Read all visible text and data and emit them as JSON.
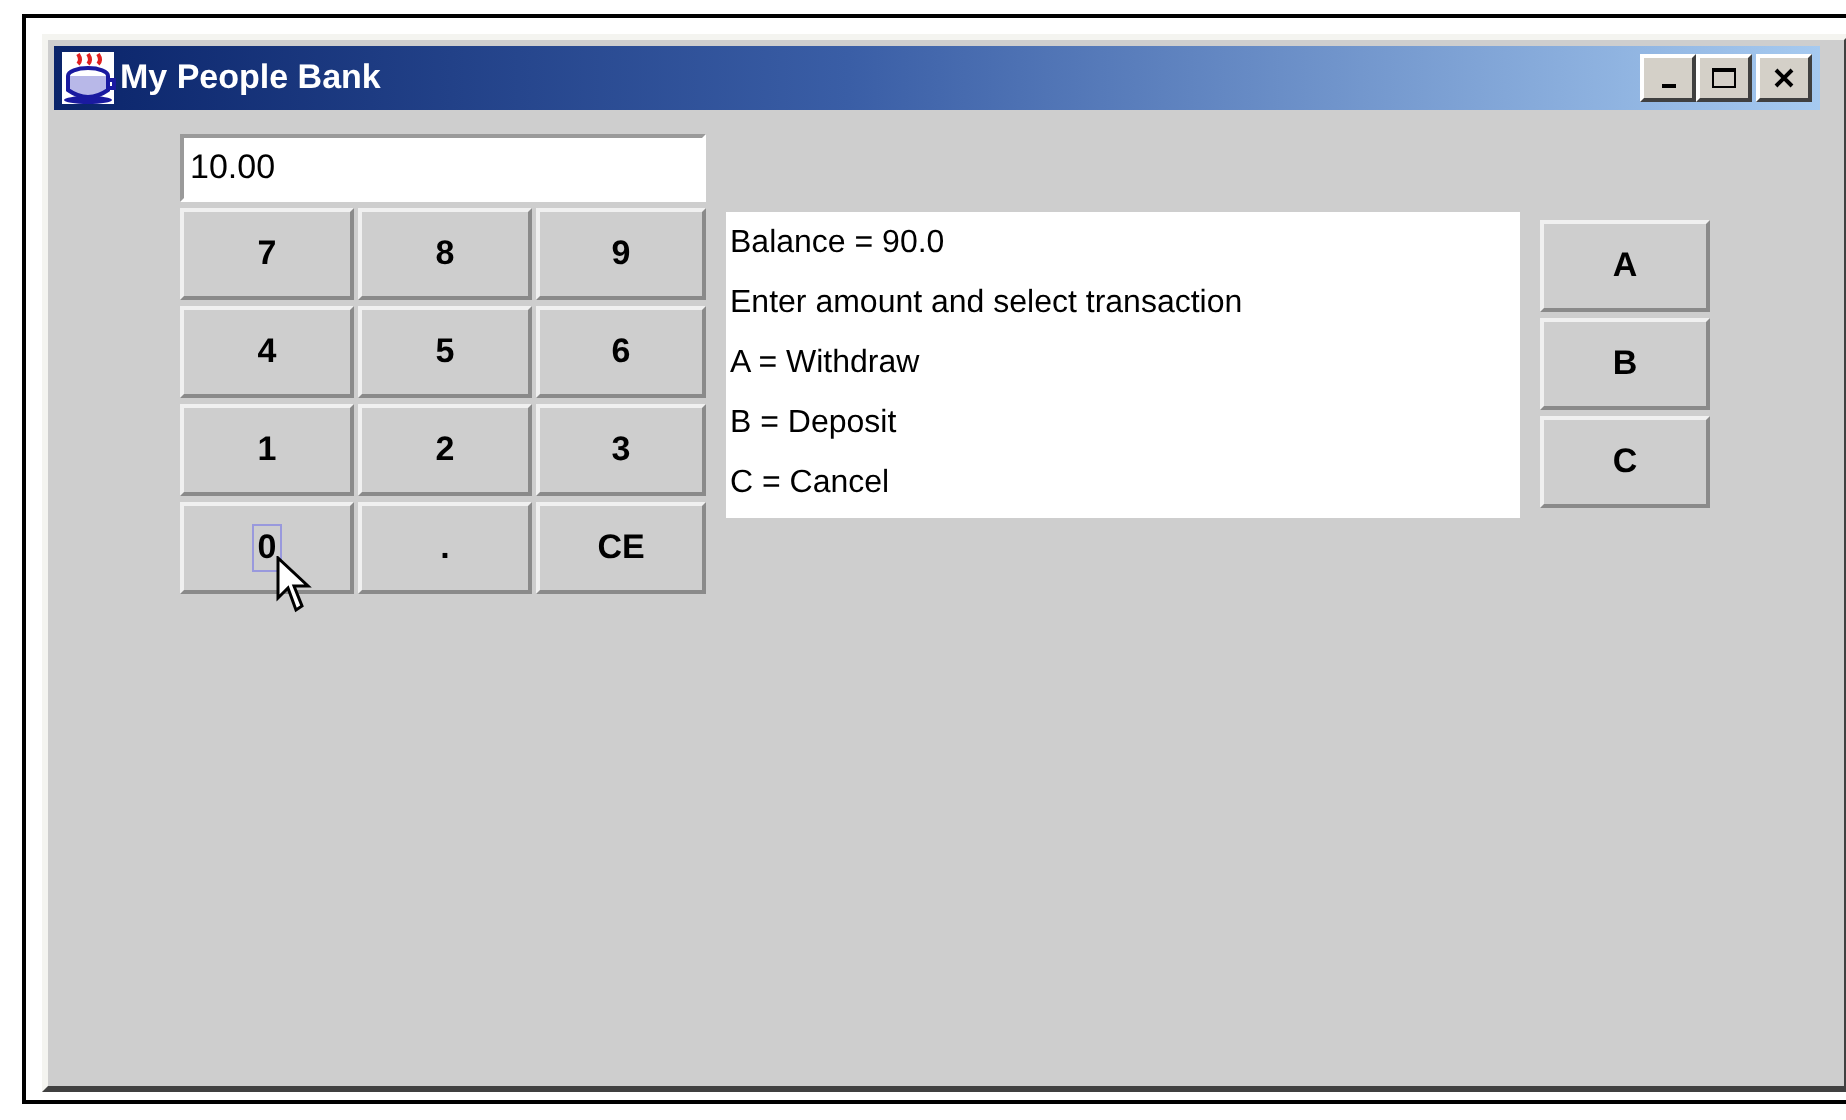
{
  "window": {
    "title": "My People Bank"
  },
  "amount_field": {
    "value": "10.00"
  },
  "keypad": [
    {
      "label": "7",
      "focused": false
    },
    {
      "label": "8",
      "focused": false
    },
    {
      "label": "9",
      "focused": false
    },
    {
      "label": "4",
      "focused": false
    },
    {
      "label": "5",
      "focused": false
    },
    {
      "label": "6",
      "focused": false
    },
    {
      "label": "1",
      "focused": false
    },
    {
      "label": "2",
      "focused": false
    },
    {
      "label": "3",
      "focused": false
    },
    {
      "label": "0",
      "focused": true
    },
    {
      "label": ".",
      "focused": false
    },
    {
      "label": "CE",
      "focused": false
    }
  ],
  "message_lines": [
    "Balance = 90.0",
    "Enter amount and select transaction",
    "A = Withdraw",
    "B = Deposit",
    "C = Cancel"
  ],
  "transaction_buttons": [
    "A",
    "B",
    "C"
  ]
}
